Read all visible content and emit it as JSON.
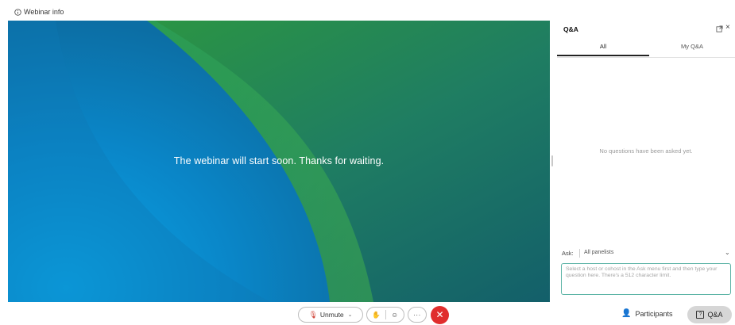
{
  "header": {
    "webinar_info": "Webinar info",
    "info_icon": "info-icon"
  },
  "stage": {
    "message": "The webinar will start soon. Thanks for waiting."
  },
  "qa_panel": {
    "title": "Q&A",
    "tabs": [
      {
        "label": "All",
        "selected": true
      },
      {
        "label": "My Q&A",
        "selected": false
      }
    ],
    "empty_message": "No questions have been asked yet.",
    "ask_label": "Ask:",
    "ask_selected": "All panelists",
    "ask_placeholder": "Select a host or cohost in the Ask menu first and then type your question here. There's a 512 character limit.",
    "icons": {
      "popout": "popout-icon",
      "close": "close-icon"
    }
  },
  "controls": {
    "unmute_label": "Unmute",
    "participants_label": "Participants",
    "qa_label": "Q&A",
    "more_label": "···",
    "leave_symbol": "✕"
  },
  "colors": {
    "leave_red": "#e02d2d",
    "stage_blue": "#0a7fbf",
    "stage_green": "#3aa33a",
    "input_border": "#5ab3a5"
  }
}
